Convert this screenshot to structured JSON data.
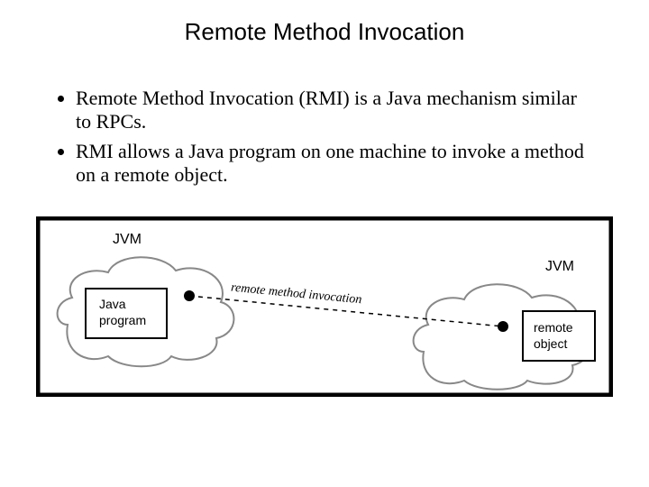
{
  "title": "Remote Method Invocation",
  "bullets": [
    "Remote Method Invocation (RMI) is a Java mechanism similar to RPCs.",
    "RMI allows a Java program on one machine to invoke a method on a remote object."
  ],
  "figure": {
    "left_cloud_label": "JVM",
    "right_cloud_label": "JVM",
    "left_box_line1": "Java",
    "left_box_line2": "program",
    "right_box_line1": "remote",
    "right_box_line2": "object",
    "edge_label": "remote method invocation"
  }
}
